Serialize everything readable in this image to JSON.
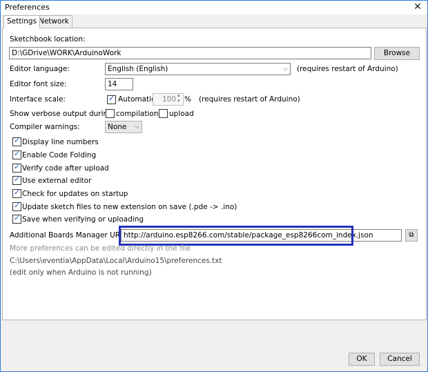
{
  "window": {
    "title": "Preferences"
  },
  "tabs": [
    {
      "label": "Settings"
    },
    {
      "label": "Network"
    }
  ],
  "settings": {
    "sketchbook_label": "Sketchbook location:",
    "sketchbook_value": "D:\\GDrive\\WORK\\ArduinoWork",
    "browse_label": "Browse",
    "editor_language_label": "Editor language:",
    "editor_language_value": "English (English)",
    "editor_language_note": "(requires restart of Arduino)",
    "font_size_label": "Editor font size:",
    "font_size_value": "14",
    "interface_scale_label": "Interface scale:",
    "automatic_label": "Automatic",
    "scale_value": "100",
    "percent": "%",
    "interface_scale_note": "(requires restart of Arduino)",
    "verbose_label": "Show verbose output during:",
    "compilation_label": "compilation",
    "upload_label": "upload",
    "compiler_warnings_label": "Compiler warnings:",
    "compiler_warnings_value": "None",
    "checkboxes": [
      {
        "label": "Display line numbers",
        "checked": true
      },
      {
        "label": "Enable Code Folding",
        "checked": true
      },
      {
        "label": "Verify code after upload",
        "checked": true
      },
      {
        "label": "Use external editor",
        "checked": true
      },
      {
        "label": "Check for updates on startup",
        "checked": true
      },
      {
        "label": "Update sketch files to new extension on save (.pde -> .ino)",
        "checked": true
      },
      {
        "label": "Save when verifying or uploading",
        "checked": true
      }
    ],
    "boards_url_label": "Additional Boards Manager URLs:",
    "boards_url_value": "http://arduino.esp8266.com/stable/package_esp8266com_index.json",
    "more_prefs_note": "More preferences can be edited directly in the file",
    "prefs_path": "C:\\Users\\eventia\\AppData\\Local\\Arduino15\\preferences.txt",
    "edit_note": "(edit only when Arduino is not running)"
  },
  "footer": {
    "ok_label": "OK",
    "cancel_label": "Cancel"
  },
  "colors": {
    "highlight_box": "#2233bb",
    "check": "#1f5fbf"
  }
}
